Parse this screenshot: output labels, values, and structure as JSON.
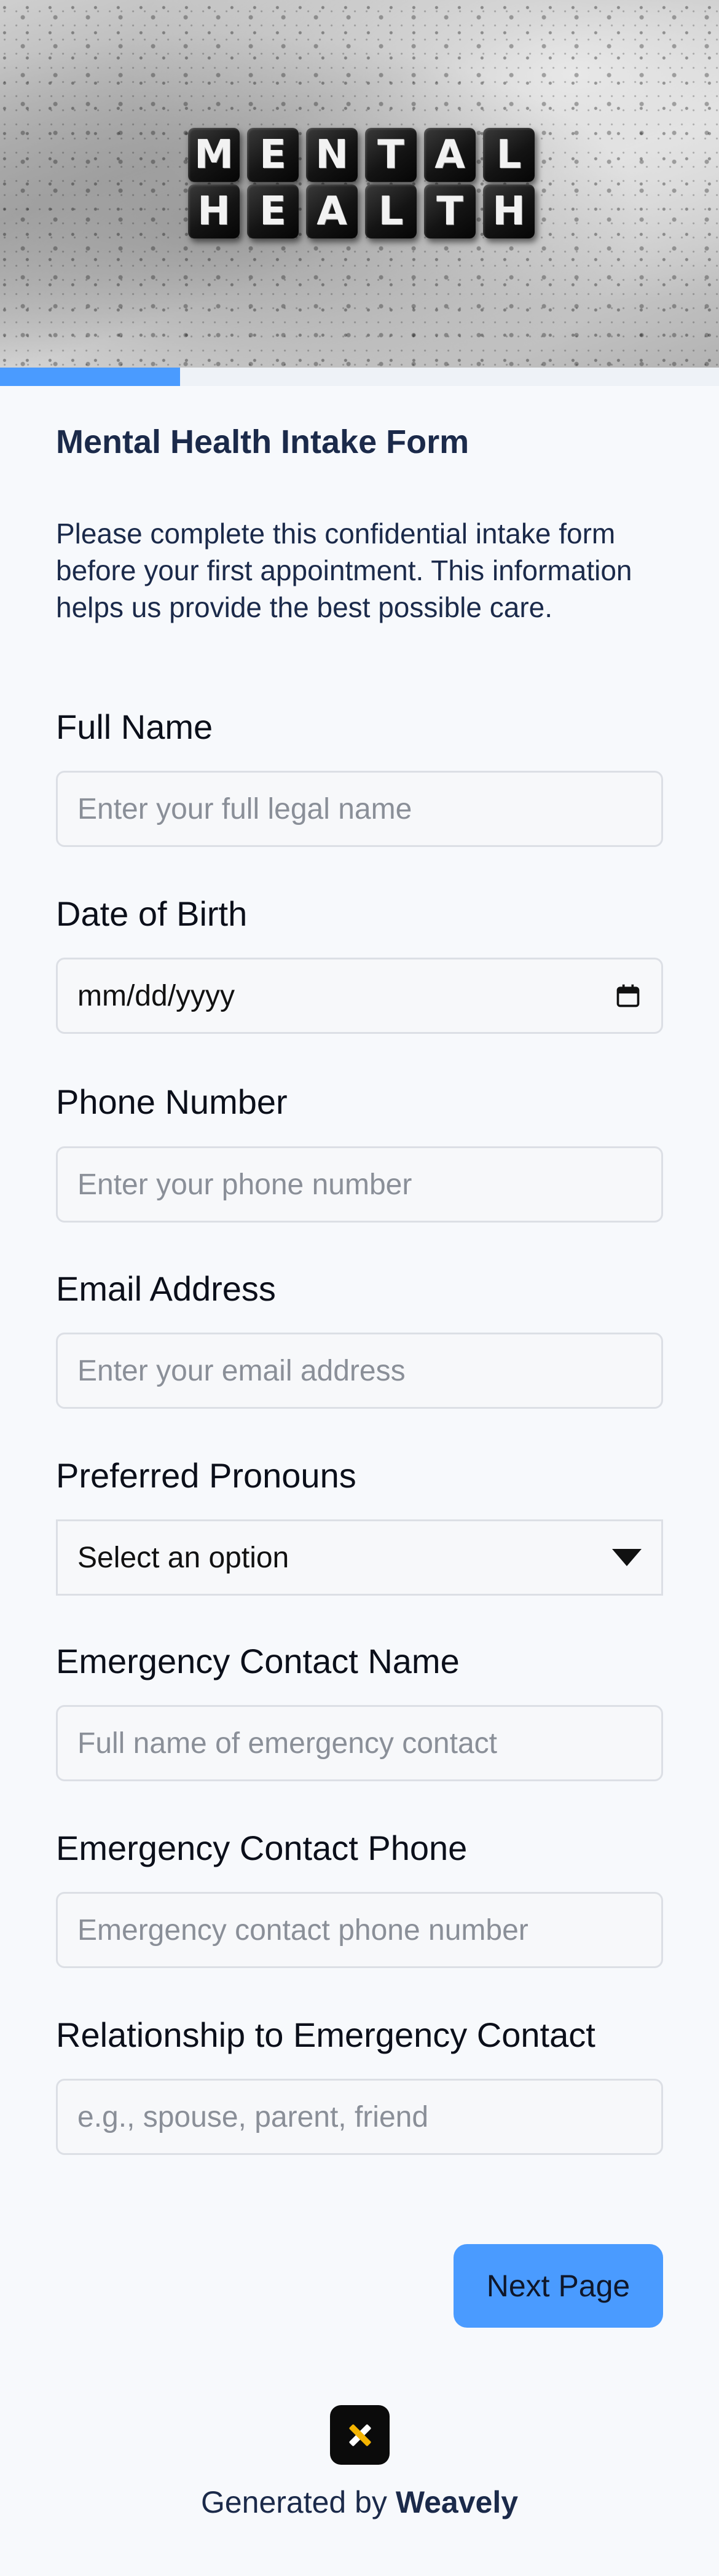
{
  "hero": {
    "image_alt_words": [
      "MENTAL",
      "HEALTH"
    ]
  },
  "progress": {
    "fraction": 0.25,
    "color": "#4a9bff"
  },
  "form": {
    "title": "Mental Health Intake Form",
    "description": "Please complete this confidential intake form before your first appointment. This information helps us provide the best possible care.",
    "fields": [
      {
        "label": "Full Name",
        "placeholder": "Enter your full legal name",
        "type": "text"
      },
      {
        "label": "Date of Birth",
        "value": "mm/dd/yyyy",
        "type": "date"
      },
      {
        "label": "Phone Number",
        "placeholder": "Enter your phone number",
        "type": "tel"
      },
      {
        "label": "Email Address",
        "placeholder": "Enter your email address",
        "type": "email"
      },
      {
        "label": "Preferred Pronouns",
        "value": "Select an option",
        "type": "select"
      },
      {
        "label": "Emergency Contact Name",
        "placeholder": "Full name of emergency contact",
        "type": "text"
      },
      {
        "label": "Emergency Contact Phone",
        "placeholder": "Emergency contact phone number",
        "type": "tel"
      },
      {
        "label": "Relationship to Emergency Contact",
        "placeholder": "e.g., spouse, parent, friend",
        "type": "text"
      }
    ],
    "next_button": "Next Page"
  },
  "footer": {
    "prefix": "Generated by",
    "brand": "Weavely"
  },
  "colors": {
    "accent": "#4a9bff",
    "title": "#1b2a4a",
    "background": "#f7f9fc"
  },
  "icons": {
    "calendar": "calendar-icon",
    "dropdown": "chevron-down-icon",
    "brand_logo": "weavely-logo-icon"
  }
}
